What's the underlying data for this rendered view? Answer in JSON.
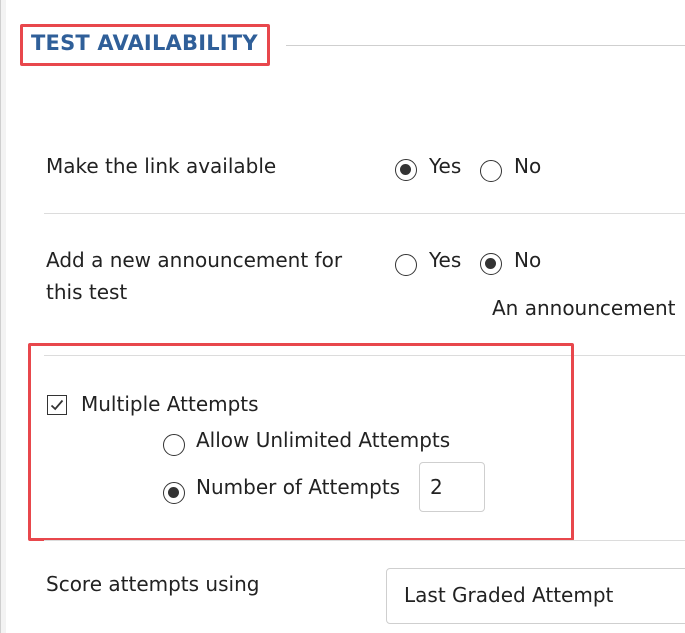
{
  "section": {
    "title": "TEST AVAILABILITY",
    "highlight_color": "#e8474c",
    "title_color": "#2f5f99"
  },
  "make_link_available": {
    "label": "Make the link available",
    "yes_label": "Yes",
    "no_label": "No",
    "selected": "Yes"
  },
  "announcement": {
    "label_line1": "Add a new announcement for",
    "label_line2": "this test",
    "yes_label": "Yes",
    "no_label": "No",
    "selected": "No",
    "note": "An announcement"
  },
  "multiple_attempts": {
    "label": "Multiple Attempts",
    "checked": true,
    "unlimited_label": "Allow Unlimited Attempts",
    "number_label": "Number of Attempts",
    "selected": "Number of Attempts",
    "number_value": "2"
  },
  "score_attempts": {
    "label": "Score attempts using",
    "selected_value": "Last Graded Attempt"
  }
}
